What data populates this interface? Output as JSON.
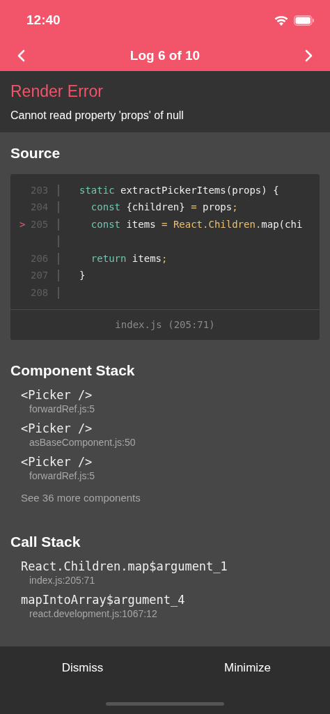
{
  "status_bar": {
    "time": "12:40"
  },
  "nav": {
    "title": "Log 6 of 10"
  },
  "error": {
    "title": "Render Error",
    "message": "Cannot read property 'props' of null"
  },
  "source": {
    "title": "Source",
    "file": "index.js (205:71)",
    "lines": [
      {
        "kind": "code",
        "number": "203",
        "tokens": [
          {
            "text": "static",
            "kind": "keyword"
          },
          {
            "text": " extractPickerItems(props) {",
            "kind": "plain"
          }
        ]
      },
      {
        "kind": "code",
        "number": "204",
        "tokens": [
          {
            "text": "  const",
            "kind": "keyword"
          },
          {
            "text": " {children} ",
            "kind": "plain"
          },
          {
            "text": "=",
            "kind": "punct"
          },
          {
            "text": " props",
            "kind": "plain"
          },
          {
            "text": ";",
            "kind": "punct"
          }
        ]
      },
      {
        "kind": "code",
        "number": "205",
        "marker": ">",
        "tokens": [
          {
            "text": "  const",
            "kind": "keyword"
          },
          {
            "text": " items ",
            "kind": "plain"
          },
          {
            "text": "=",
            "kind": "punct"
          },
          {
            "text": " React.Children.",
            "kind": "type"
          },
          {
            "text": "map(chi",
            "kind": "plain"
          }
        ]
      },
      {
        "kind": "wrap"
      },
      {
        "kind": "code",
        "number": "206",
        "tokens": [
          {
            "text": "  return",
            "kind": "keyword"
          },
          {
            "text": " items",
            "kind": "plain"
          },
          {
            "text": ";",
            "kind": "punct"
          }
        ]
      },
      {
        "kind": "code",
        "number": "207",
        "tokens": [
          {
            "text": "}",
            "kind": "plain"
          }
        ]
      },
      {
        "kind": "code",
        "number": "208"
      }
    ]
  },
  "component_stack": {
    "title": "Component Stack",
    "items": [
      {
        "name": "<Picker />",
        "location": "forwardRef.js:5"
      },
      {
        "name": "<Picker />",
        "location": "asBaseComponent.js:50"
      },
      {
        "name": "<Picker />",
        "location": "forwardRef.js:5"
      }
    ],
    "more": "See 36 more components"
  },
  "call_stack": {
    "title": "Call Stack",
    "items": [
      {
        "name": "React.Children.map$argument_1",
        "location": "index.js:205:71"
      },
      {
        "name": "mapIntoArray$argument_4",
        "location": "react.development.js:1067:12"
      }
    ]
  },
  "footer": {
    "buttons": [
      "Dismiss",
      "Minimize"
    ]
  }
}
